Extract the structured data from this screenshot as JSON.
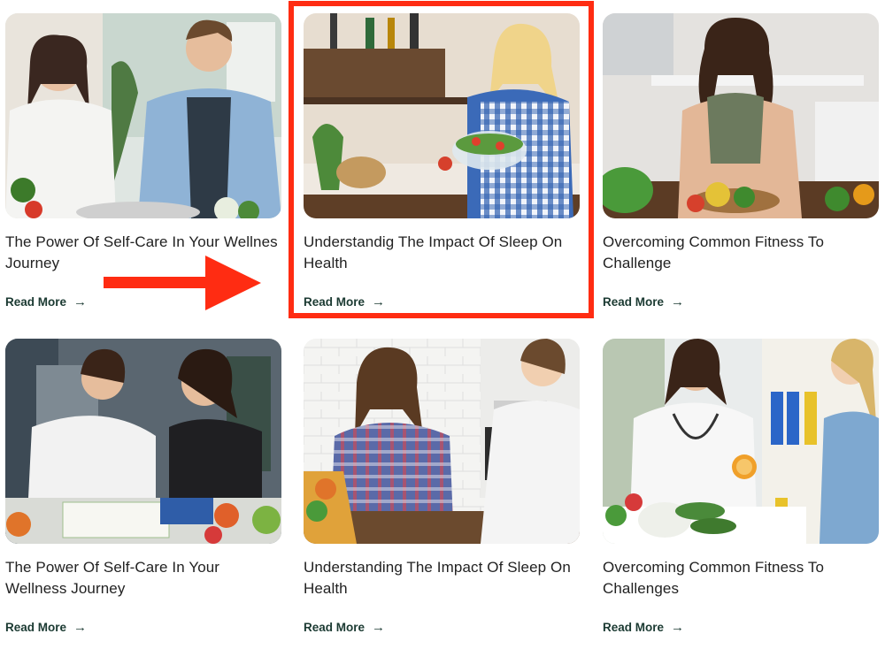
{
  "cards": [
    {
      "title": "The Power Of Self-Care In Your Wellnes Journey",
      "read_more": "Read More",
      "image": "couple-healthy-food-photo"
    },
    {
      "title": "Understandig The Impact Of Sleep On Health",
      "read_more": "Read More",
      "image": "woman-salad-bowl-photo"
    },
    {
      "title": "Overcoming Common Fitness To Challenge",
      "read_more": "Read More",
      "image": "woman-cutting-vegetables-photo"
    },
    {
      "title": "The Power Of Self-Care In Your Wellness Journey",
      "read_more": "Read More",
      "image": "two-women-meal-plan-photo"
    },
    {
      "title": "Understanding The Impact Of Sleep On Health",
      "read_more": "Read More",
      "image": "woman-consultation-photo"
    },
    {
      "title": "Overcoming Common Fitness To Challenges",
      "read_more": "Read More",
      "image": "doctor-patient-vegetables-photo"
    }
  ],
  "icons": {
    "read_more_arrow": "→",
    "annotation": "red-arrow-right"
  },
  "colors": {
    "annotation_red": "#ff2c12",
    "read_more_text": "#1b3a32",
    "title_text": "#222222"
  }
}
